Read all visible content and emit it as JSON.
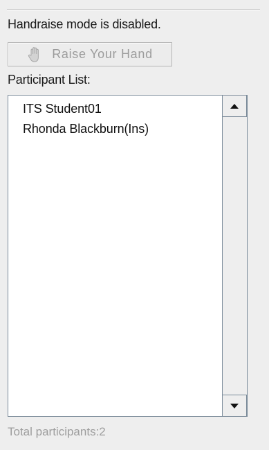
{
  "handraise": {
    "status_text": "Handraise mode is disabled.",
    "raise_button_label": "Raise Your Hand",
    "raise_button_icon": "hand-icon",
    "raise_button_enabled": false
  },
  "participants": {
    "list_title": "Participant List:",
    "items": [
      {
        "name": "ITS Student01"
      },
      {
        "name": "Rhonda Blackburn(Ins)"
      }
    ],
    "total_text": "Total participants:2"
  },
  "colors": {
    "panel_bg": "#eeeeee",
    "list_bg": "#ffffff",
    "list_border": "#7a8a99",
    "disabled_text": "#9c9c9c"
  }
}
